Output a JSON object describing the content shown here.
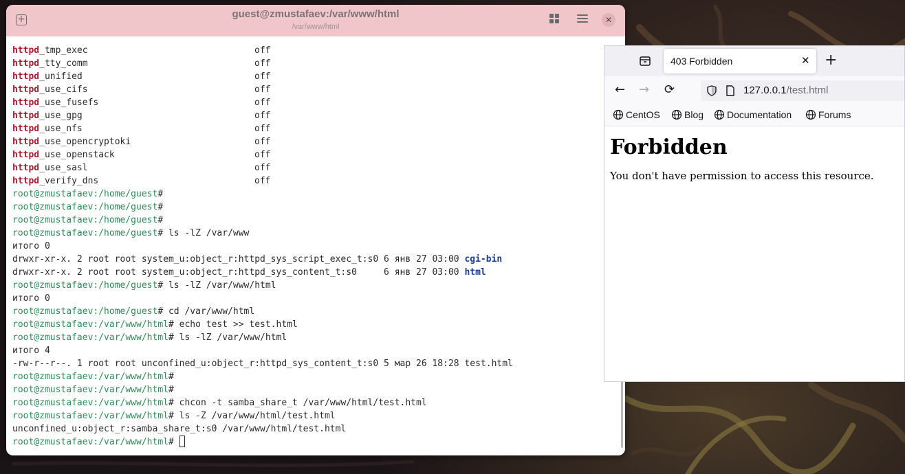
{
  "terminal": {
    "title": "guest@zmustafaev:/var/www/html",
    "subtitle": "/var/www/html",
    "boolean_rows": [
      {
        "prefix": "httpd",
        "suffix": "_tmp_exec",
        "value": "off"
      },
      {
        "prefix": "httpd",
        "suffix": "_tty_comm",
        "value": "off"
      },
      {
        "prefix": "httpd",
        "suffix": "_unified",
        "value": "off"
      },
      {
        "prefix": "httpd",
        "suffix": "_use_cifs",
        "value": "off"
      },
      {
        "prefix": "httpd",
        "suffix": "_use_fusefs",
        "value": "off"
      },
      {
        "prefix": "httpd",
        "suffix": "_use_gpg",
        "value": "off"
      },
      {
        "prefix": "httpd",
        "suffix": "_use_nfs",
        "value": "off"
      },
      {
        "prefix": "httpd",
        "suffix": "_use_opencryptoki",
        "value": "off"
      },
      {
        "prefix": "httpd",
        "suffix": "_use_openstack",
        "value": "off"
      },
      {
        "prefix": "httpd",
        "suffix": "_use_sasl",
        "value": "off"
      },
      {
        "prefix": "httpd",
        "suffix": "_verify_dns",
        "value": "off"
      }
    ],
    "lines": [
      {
        "kind": "prompt",
        "prompt": "root@zmustafaev:/home/guest",
        "cmd": ""
      },
      {
        "kind": "prompt",
        "prompt": "root@zmustafaev:/home/guest",
        "cmd": ""
      },
      {
        "kind": "prompt",
        "prompt": "root@zmustafaev:/home/guest",
        "cmd": ""
      },
      {
        "kind": "prompt",
        "prompt": "root@zmustafaev:/home/guest",
        "cmd": " ls -lZ /var/www"
      },
      {
        "kind": "text",
        "text": "итого 0"
      },
      {
        "kind": "dir",
        "text": "drwxr-xr-x. 2 root root system_u:object_r:httpd_sys_script_exec_t:s0 6 янв 27 03:00 ",
        "name": "cgi-bin"
      },
      {
        "kind": "dir",
        "text": "drwxr-xr-x. 2 root root system_u:object_r:httpd_sys_content_t:s0     6 янв 27 03:00 ",
        "name": "html"
      },
      {
        "kind": "prompt",
        "prompt": "root@zmustafaev:/home/guest",
        "cmd": " ls -lZ /var/www/html"
      },
      {
        "kind": "text",
        "text": "итого 0"
      },
      {
        "kind": "prompt",
        "prompt": "root@zmustafaev:/home/guest",
        "cmd": " cd /var/www/html"
      },
      {
        "kind": "prompt",
        "prompt": "root@zmustafaev:/var/www/html",
        "cmd": " echo test >> test.html"
      },
      {
        "kind": "prompt",
        "prompt": "root@zmustafaev:/var/www/html",
        "cmd": " ls -lZ /var/www/html"
      },
      {
        "kind": "text",
        "text": "итого 4"
      },
      {
        "kind": "text",
        "text": "-rw-r--r--. 1 root root unconfined_u:object_r:httpd_sys_content_t:s0 5 мар 26 18:28 test.html"
      },
      {
        "kind": "prompt",
        "prompt": "root@zmustafaev:/var/www/html",
        "cmd": ""
      },
      {
        "kind": "prompt",
        "prompt": "root@zmustafaev:/var/www/html",
        "cmd": ""
      },
      {
        "kind": "prompt",
        "prompt": "root@zmustafaev:/var/www/html",
        "cmd": " chcon -t samba_share_t /var/www/html/test.html"
      },
      {
        "kind": "prompt",
        "prompt": "root@zmustafaev:/var/www/html",
        "cmd": " ls -Z /var/www/html/test.html"
      },
      {
        "kind": "text",
        "text": "unconfined_u:object_r:samba_share_t:s0 /var/www/html/test.html"
      },
      {
        "kind": "active",
        "prompt": "root@zmustafaev:/var/www/html",
        "cmd": " "
      }
    ],
    "colors": {
      "header": "#f0c6ca",
      "prompt": "#2e8b57",
      "highlight": "#b2182b",
      "dir": "#1c3f94"
    }
  },
  "browser": {
    "tab_title": "403 Forbidden",
    "url_host": "127.0.0.1",
    "url_path": "/test.html",
    "bookmarks": [
      "CentOS",
      "Blog",
      "Documentation",
      "Forums"
    ],
    "page_heading": "Forbidden",
    "page_text": "You don't have permission to access this resource."
  }
}
